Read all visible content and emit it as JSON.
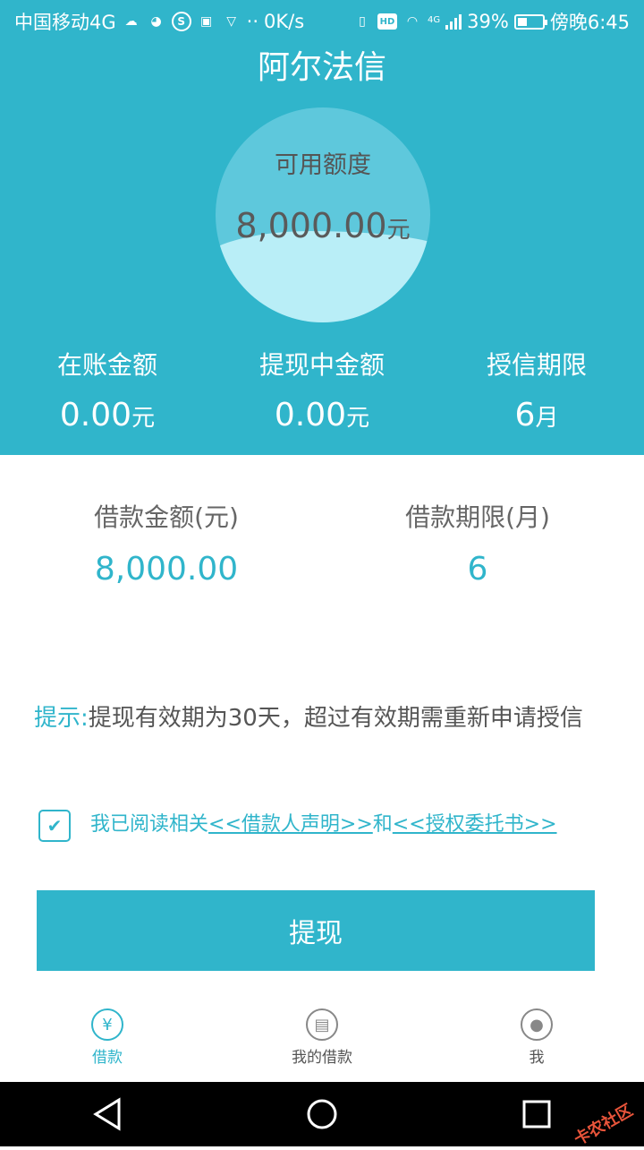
{
  "status_bar": {
    "carrier": "中国移动4G",
    "speed": "0K/s",
    "battery": "39%",
    "battery_level": 0.39,
    "time": "傍晚6:45",
    "hd": "HD",
    "s_icon": "S",
    "net_label": "4G"
  },
  "header": {
    "title": "阿尔法信",
    "quota_label": "可用额度",
    "quota_value": "8,000.00",
    "quota_unit": "元"
  },
  "stats": [
    {
      "label": "在账金额",
      "value": "0.00",
      "unit": "元"
    },
    {
      "label": "提现中金额",
      "value": "0.00",
      "unit": "元"
    },
    {
      "label": "授信期限",
      "value": "6",
      "unit": "月"
    }
  ],
  "loan": {
    "amount_label": "借款金额(元)",
    "amount_value": "8,000.00",
    "term_label": "借款期限(月)",
    "term_value": "6"
  },
  "tip": {
    "prefix": "提示:",
    "text": "提现有效期为30天，超过有效期需重新申请授信"
  },
  "agreement": {
    "checked": true,
    "text_before": "我已阅读相关",
    "link1": "<<借款人声明>>",
    "text_middle": "和",
    "link2": "<<授权委托书>>"
  },
  "withdraw_button": "提现",
  "tabs": [
    {
      "label": "借款",
      "icon": "money-bag-icon",
      "glyph": "¥",
      "active": true
    },
    {
      "label": "我的借款",
      "icon": "document-icon",
      "glyph": "▤",
      "active": false
    },
    {
      "label": "我",
      "icon": "user-icon",
      "glyph": "●",
      "active": false
    }
  ],
  "watermark": "卡农社区",
  "colors": {
    "accent": "#30b5cb",
    "circle": "#5ec8dc",
    "wave": "#b9eef7",
    "watermark": "#e8543a"
  }
}
